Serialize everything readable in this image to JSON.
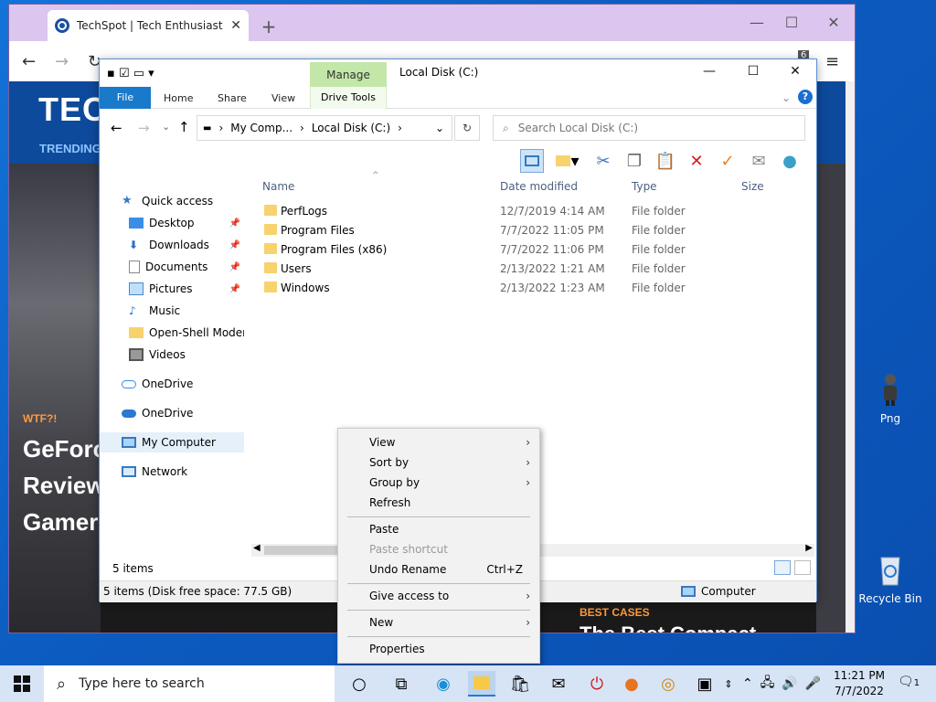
{
  "desktop": {
    "icons": [
      {
        "label": "Png"
      },
      {
        "label": "Recycle Bin"
      }
    ]
  },
  "browser": {
    "tab_title": "TechSpot | Tech Enthusiasts, Po",
    "page": {
      "logo": "TEC",
      "trending": "TRENDING",
      "hero_tag": "WTF?!",
      "hero_title": "GeForc Review Gamers",
      "best_cases_tag": "BEST CASES",
      "best_cases_title": "The Best Compact",
      "badge": "6"
    }
  },
  "explorer": {
    "manage_label": "Manage",
    "title": "Local Disk (C:)",
    "ribbon_tabs": [
      "File",
      "Home",
      "Share",
      "View",
      "Drive Tools"
    ],
    "address": [
      "My Comp...",
      "Local Disk (C:)"
    ],
    "search_placeholder": "Search Local Disk (C:)",
    "nav_items": [
      {
        "label": "Quick access",
        "icon": "star-icon"
      },
      {
        "label": "Desktop",
        "icon": "desktop-icon",
        "pinned": true
      },
      {
        "label": "Downloads",
        "icon": "download-icon",
        "pinned": true
      },
      {
        "label": "Documents",
        "icon": "document-icon",
        "pinned": true
      },
      {
        "label": "Pictures",
        "icon": "pictures-icon",
        "pinned": true
      },
      {
        "label": "Music",
        "icon": "music-icon"
      },
      {
        "label": "Open-Shell Modern",
        "icon": "folder-icon"
      },
      {
        "label": "Videos",
        "icon": "video-icon"
      },
      {
        "label": "OneDrive",
        "icon": "cloud-icon"
      },
      {
        "label": "OneDrive",
        "icon": "cloud-icon"
      },
      {
        "label": "My Computer",
        "icon": "computer-icon",
        "selected": true
      },
      {
        "label": "Network",
        "icon": "network-icon"
      }
    ],
    "columns": [
      "Name",
      "Date modified",
      "Type",
      "Size"
    ],
    "files": [
      {
        "name": "PerfLogs",
        "date": "12/7/2019 4:14 AM",
        "type": "File folder"
      },
      {
        "name": "Program Files",
        "date": "7/7/2022 11:05 PM",
        "type": "File folder"
      },
      {
        "name": "Program Files (x86)",
        "date": "7/7/2022 11:06 PM",
        "type": "File folder"
      },
      {
        "name": "Users",
        "date": "2/13/2022 1:21 AM",
        "type": "File folder"
      },
      {
        "name": "Windows",
        "date": "2/13/2022 1:23 AM",
        "type": "File folder"
      }
    ],
    "item_count": "5 items",
    "status_left": "5 items (Disk free space: 77.5 GB)",
    "status_right": "Computer"
  },
  "context_menu": {
    "items": [
      {
        "label": "View",
        "submenu": true
      },
      {
        "label": "Sort by",
        "submenu": true
      },
      {
        "label": "Group by",
        "submenu": true
      },
      {
        "label": "Refresh"
      },
      {
        "label": "Paste"
      },
      {
        "label": "Paste shortcut",
        "disabled": true
      },
      {
        "label": "Undo Rename",
        "shortcut": "Ctrl+Z"
      },
      {
        "label": "Give access to",
        "submenu": true
      },
      {
        "label": "New",
        "submenu": true
      },
      {
        "label": "Properties"
      }
    ]
  },
  "taskbar": {
    "search_placeholder": "Type here to search",
    "time": "11:21 PM",
    "date": "7/7/2022",
    "notification_count": "1"
  },
  "colors": {
    "desktop": "#0c5bc0",
    "browser_titlebar": "#dcc6ef",
    "file_tab": "#1979ca",
    "manage_tab": "#c3e7a8",
    "selection": "#e5f0fb"
  }
}
